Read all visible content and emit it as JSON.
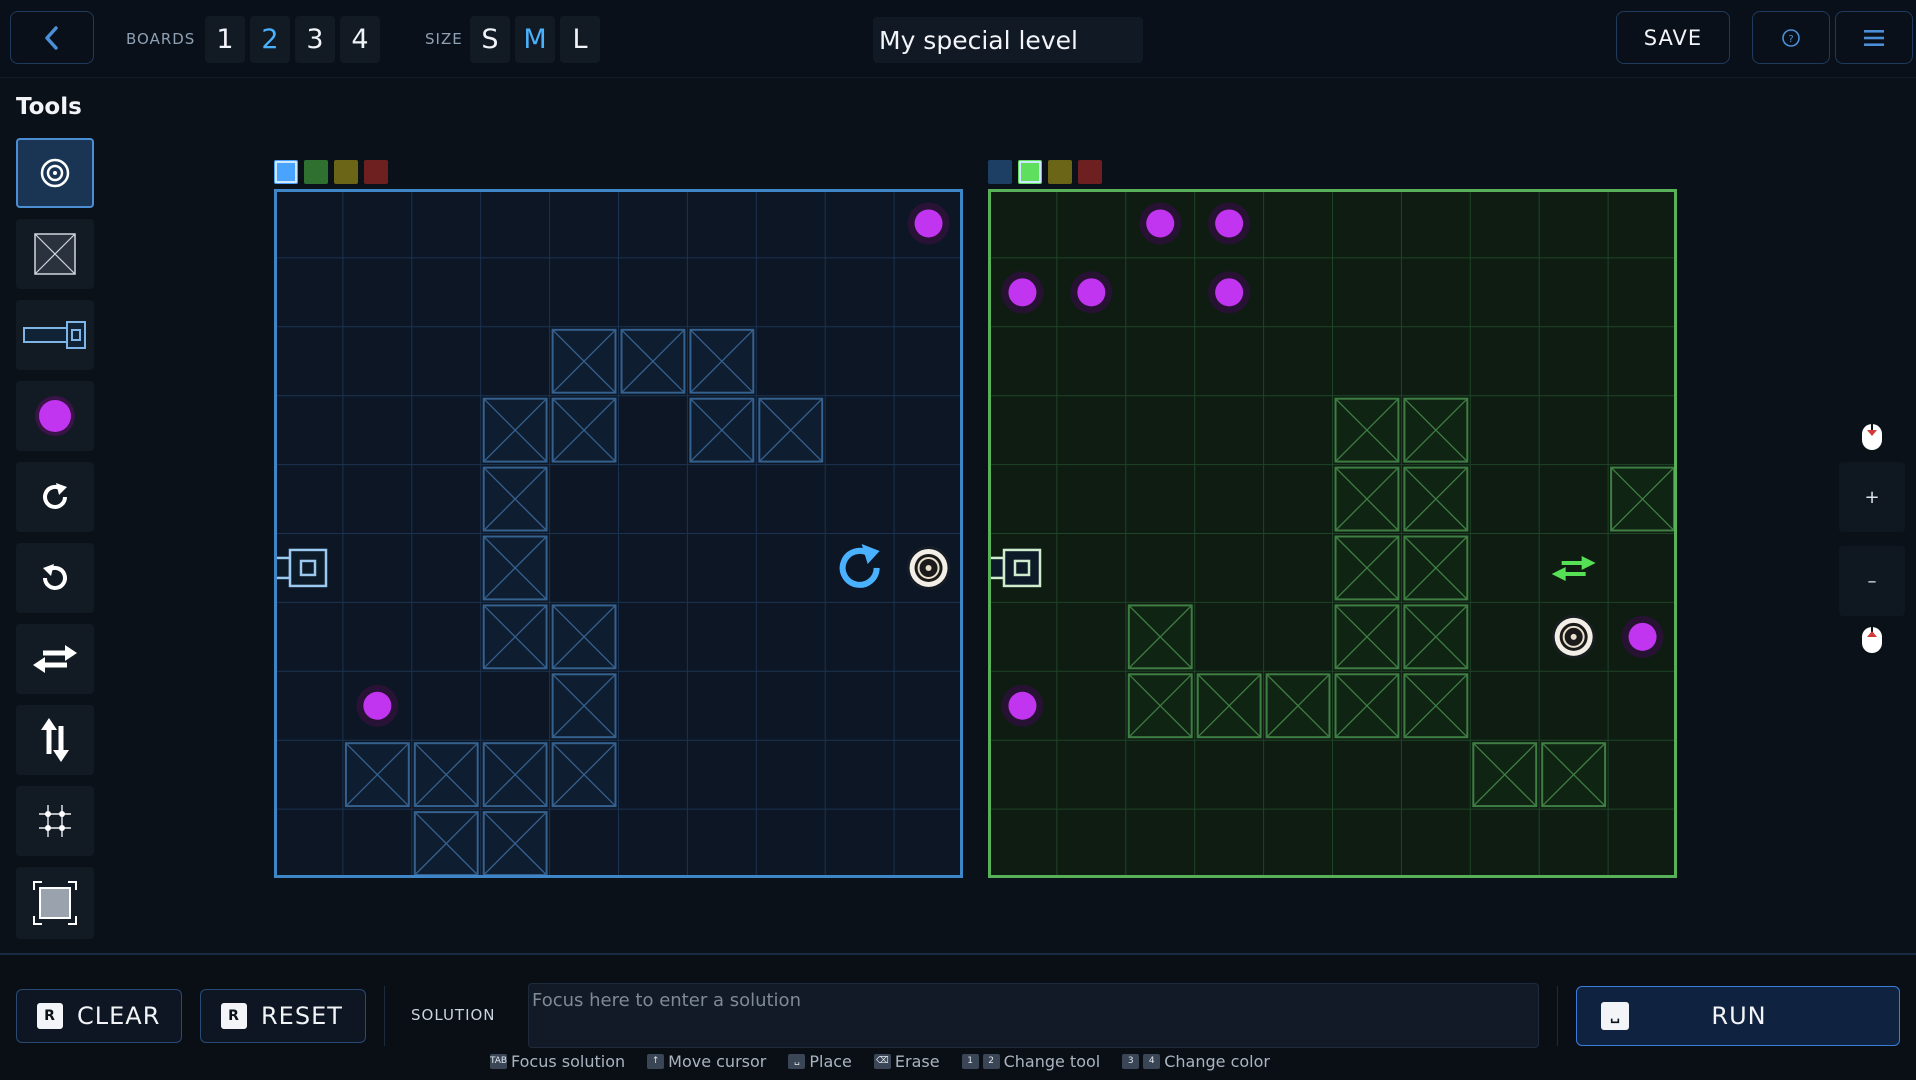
{
  "topbar": {
    "boards_label": "BOARDS",
    "boards": [
      "1",
      "2",
      "3",
      "4"
    ],
    "active_board": "2",
    "size_label": "SIZE",
    "sizes": [
      "S",
      "M",
      "L"
    ],
    "active_size": "M",
    "level_title": "My special level",
    "save_label": "SAVE",
    "icons": {
      "back": "chevron-left-icon",
      "help": "question-circle-icon",
      "menu": "hamburger-menu-icon"
    }
  },
  "tools": {
    "title": "Tools",
    "items": [
      {
        "name": "target-tool",
        "icon": "bullseye-icon",
        "active": true
      },
      {
        "name": "wall-tool",
        "icon": "crossed-box-icon",
        "active": false
      },
      {
        "name": "launcher-tool",
        "icon": "launcher-icon",
        "active": false
      },
      {
        "name": "orb-tool",
        "icon": "purple-orb-icon",
        "active": false
      },
      {
        "name": "rotate-cw-tool",
        "icon": "rotate-cw-icon",
        "active": false
      },
      {
        "name": "rotate-ccw-tool",
        "icon": "rotate-ccw-icon",
        "active": false
      },
      {
        "name": "swap-horizontal-tool",
        "icon": "swap-horizontal-icon",
        "active": false
      },
      {
        "name": "swap-vertical-tool",
        "icon": "swap-vertical-icon",
        "active": false
      },
      {
        "name": "grid-tool",
        "icon": "grid-dots-icon",
        "active": false
      },
      {
        "name": "fill-tool",
        "icon": "fill-square-icon",
        "active": false
      }
    ]
  },
  "colors": {
    "palette": [
      "#4aa3ff",
      "#2f6f2f",
      "#6b6517",
      "#6e2020"
    ],
    "palette_dim": [
      "#1d3f63",
      "#5ee05e",
      "#6b6517",
      "#6e2020"
    ],
    "orb": "#c235f0",
    "accent_blue": "#4ab1ff",
    "accent_green": "#55e055"
  },
  "boards": [
    {
      "name": "board-blue",
      "theme": "blue",
      "selected_color": 0,
      "walls": [
        [
          2,
          4
        ],
        [
          2,
          5
        ],
        [
          2,
          6
        ],
        [
          3,
          3
        ],
        [
          3,
          4
        ],
        [
          3,
          6
        ],
        [
          3,
          7
        ],
        [
          4,
          3
        ],
        [
          5,
          3
        ],
        [
          6,
          3
        ],
        [
          6,
          4
        ],
        [
          7,
          4
        ],
        [
          8,
          1
        ],
        [
          8,
          2
        ],
        [
          8,
          3
        ],
        [
          8,
          4
        ],
        [
          9,
          2
        ],
        [
          9,
          3
        ]
      ],
      "orbs": [
        [
          0,
          9
        ],
        [
          7,
          1
        ]
      ],
      "launcher": [
        5,
        0
      ],
      "targets": [
        [
          5,
          9
        ]
      ],
      "rotators": [
        [
          5,
          8
        ]
      ],
      "swappers": []
    },
    {
      "name": "board-green",
      "theme": "green",
      "selected_color": 1,
      "walls": [
        [
          3,
          5
        ],
        [
          3,
          6
        ],
        [
          4,
          5
        ],
        [
          4,
          6
        ],
        [
          4,
          9
        ],
        [
          5,
          5
        ],
        [
          5,
          6
        ],
        [
          6,
          2
        ],
        [
          6,
          5
        ],
        [
          6,
          6
        ],
        [
          7,
          2
        ],
        [
          7,
          3
        ],
        [
          7,
          4
        ],
        [
          7,
          5
        ],
        [
          7,
          6
        ],
        [
          8,
          7
        ],
        [
          8,
          8
        ]
      ],
      "orbs": [
        [
          0,
          2
        ],
        [
          0,
          3
        ],
        [
          1,
          0
        ],
        [
          1,
          1
        ],
        [
          1,
          3
        ],
        [
          6,
          9
        ],
        [
          7,
          0
        ]
      ],
      "launcher": [
        5,
        0
      ],
      "targets": [
        [
          6,
          8
        ]
      ],
      "rotators": [],
      "swappers": [
        [
          5,
          8
        ]
      ]
    }
  ],
  "side_controls": {
    "zoom_in": "+",
    "zoom_out": "–",
    "icons": {
      "mouse_top": "mouse-scroll-icon",
      "mouse_bottom": "mouse-scroll-icon"
    }
  },
  "bottombar": {
    "clear_key": "R",
    "clear_label": "CLEAR",
    "reset_key": "R",
    "reset_label": "RESET",
    "solution_label": "SOLUTION",
    "solution_placeholder": "Focus here to enter a solution",
    "run_label": "RUN",
    "hints": [
      {
        "keys": [
          "TAB"
        ],
        "label": "Focus solution"
      },
      {
        "keys": [
          "↑"
        ],
        "label": "Move cursor"
      },
      {
        "keys": [
          "␣"
        ],
        "label": "Place"
      },
      {
        "keys": [
          "⌫"
        ],
        "label": "Erase"
      },
      {
        "keys": [
          "1",
          "2"
        ],
        "label": "Change tool"
      },
      {
        "keys": [
          "3",
          "4"
        ],
        "label": "Change color"
      }
    ]
  }
}
